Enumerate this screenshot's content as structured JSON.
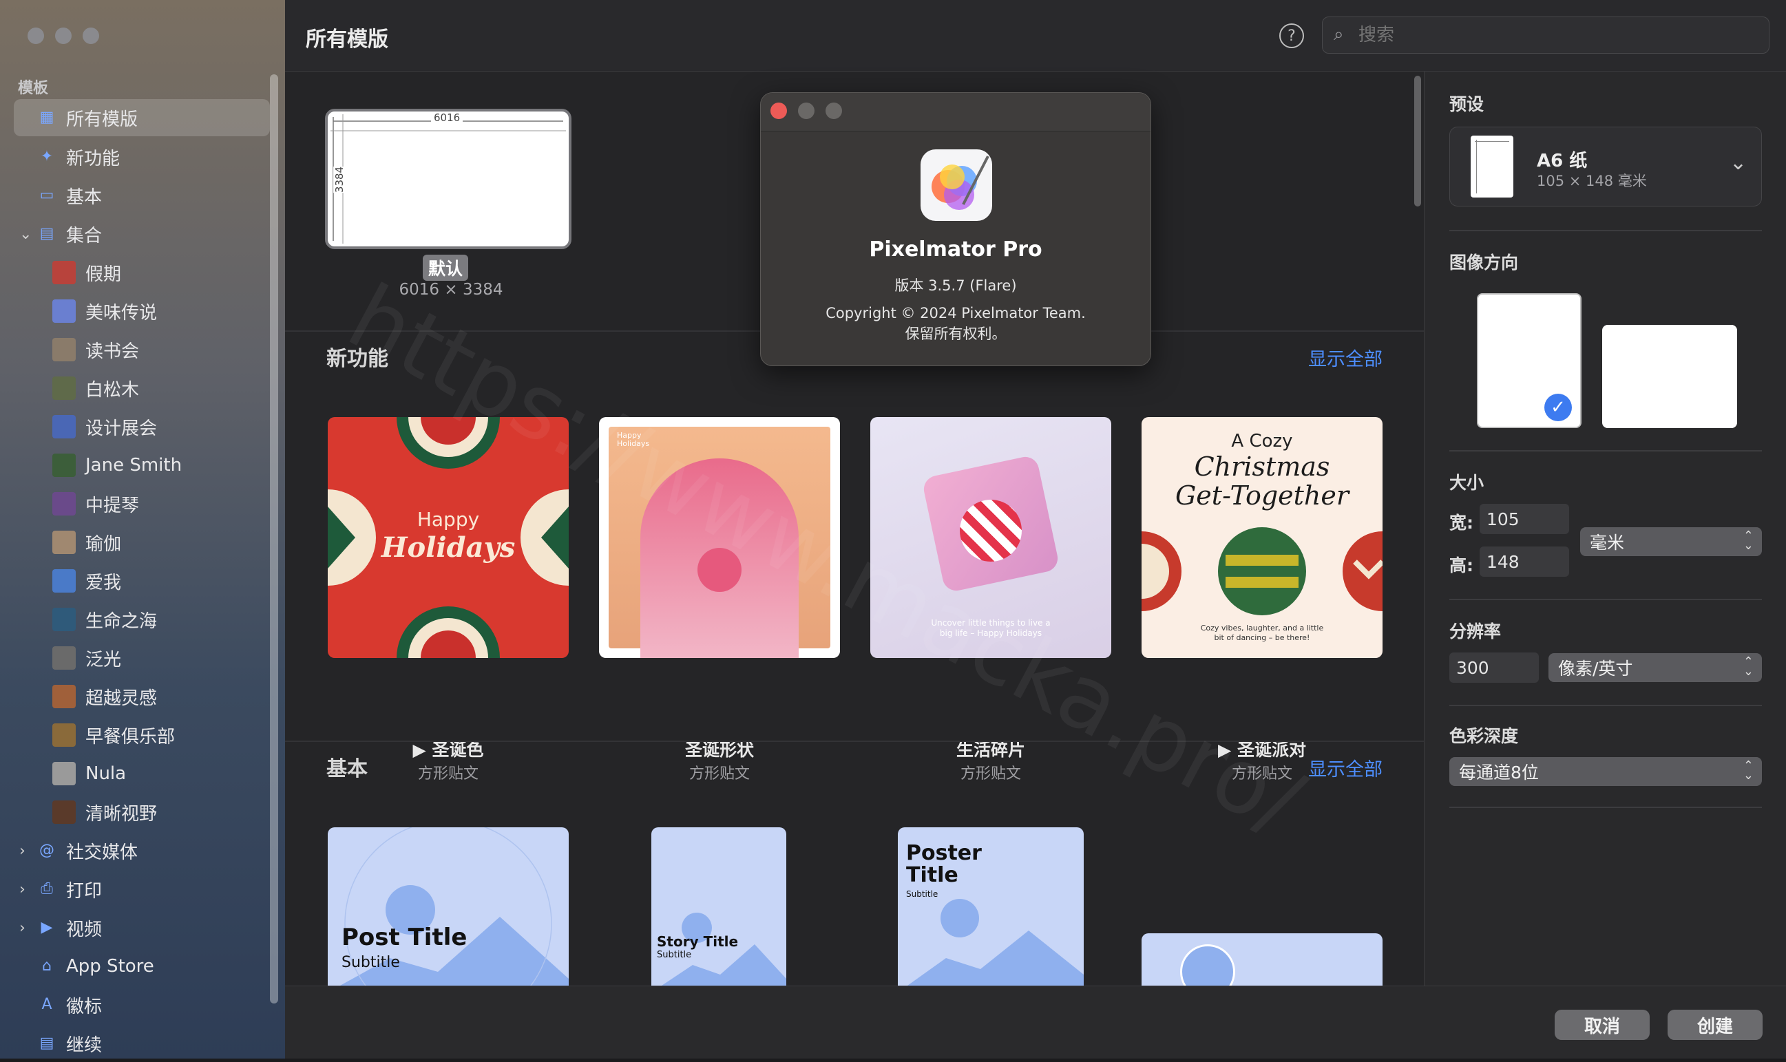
{
  "header": {
    "title": "所有模版",
    "help_icon": "question-circle-icon",
    "search_placeholder": "搜索"
  },
  "sidebar": {
    "section_label": "模板",
    "items": [
      {
        "label": "所有模版",
        "selected": true
      },
      {
        "label": "新功能"
      },
      {
        "label": "基本"
      },
      {
        "label": "集合",
        "expanded": true
      }
    ],
    "collection_items": [
      "假期",
      "美味传说",
      "读书会",
      "白松木",
      "设计展会",
      "Jane Smith",
      "中提琴",
      "瑜伽",
      "爱我",
      "生命之海",
      "泛光",
      "超越灵感",
      "早餐俱乐部",
      "Nula",
      "清晰视野"
    ],
    "bottom_items": [
      "社交媒体",
      "打印",
      "视频",
      "App Store",
      "徽标",
      "继续"
    ]
  },
  "default_template": {
    "width_label": "6016",
    "height_label": "3384",
    "name": "默认",
    "size": "6016 × 3384"
  },
  "sections": {
    "new_features": {
      "title": "新功能",
      "show_all": "显示全部",
      "cards": [
        {
          "name": "圣诞色",
          "sub": "方形贴文",
          "video": true,
          "line1": "Happy",
          "line2": "Holidays"
        },
        {
          "name": "圣诞形状",
          "sub": "方形贴文",
          "video": false,
          "tag1": "Happy",
          "tag2": "Holidays"
        },
        {
          "name": "生活碎片",
          "sub": "方形贴文",
          "video": false,
          "tagline": "Uncover little things to live a big life – Happy Holidays"
        },
        {
          "name": "圣诞派对",
          "sub": "方形贴文",
          "video": true,
          "line0": "A Cozy",
          "line1": "Christmas",
          "line2": "Get-Together",
          "tagline": "Cozy vibes, laughter, and a little bit of dancing – be there!"
        }
      ]
    },
    "basic": {
      "title": "基本",
      "show_all": "显示全部",
      "cards": [
        {
          "title": "Post Title",
          "sub": "Subtitle"
        },
        {
          "title": "Story Title",
          "sub": "Subtitle"
        },
        {
          "title": "Poster Title",
          "sub": "Subtitle"
        }
      ]
    }
  },
  "right_panel": {
    "preset_label": "预设",
    "preset_name": "A6 纸",
    "preset_size": "105 × 148 毫米",
    "orientation_label": "图像方向",
    "size_label": "大小",
    "width_label": "宽:",
    "width": "105",
    "height_label": "高:",
    "height": "148",
    "unit": "毫米",
    "resolution_label": "分辨率",
    "resolution": "300",
    "resolution_unit": "像素/英寸",
    "depth_label": "色彩深度",
    "depth": "每通道8位"
  },
  "footer": {
    "cancel": "取消",
    "create": "创建"
  },
  "about": {
    "app_name": "Pixelmator Pro",
    "version": "版本 3.5.7 (Flare)",
    "copyright": "Copyright © 2024 Pixelmator Team.",
    "rights": "保留所有权利。"
  },
  "watermark": "https://www.macka.pro/",
  "colors": {
    "accent": "#4d8eff",
    "close": "#ed5b57",
    "red_card": "#d8392f"
  }
}
